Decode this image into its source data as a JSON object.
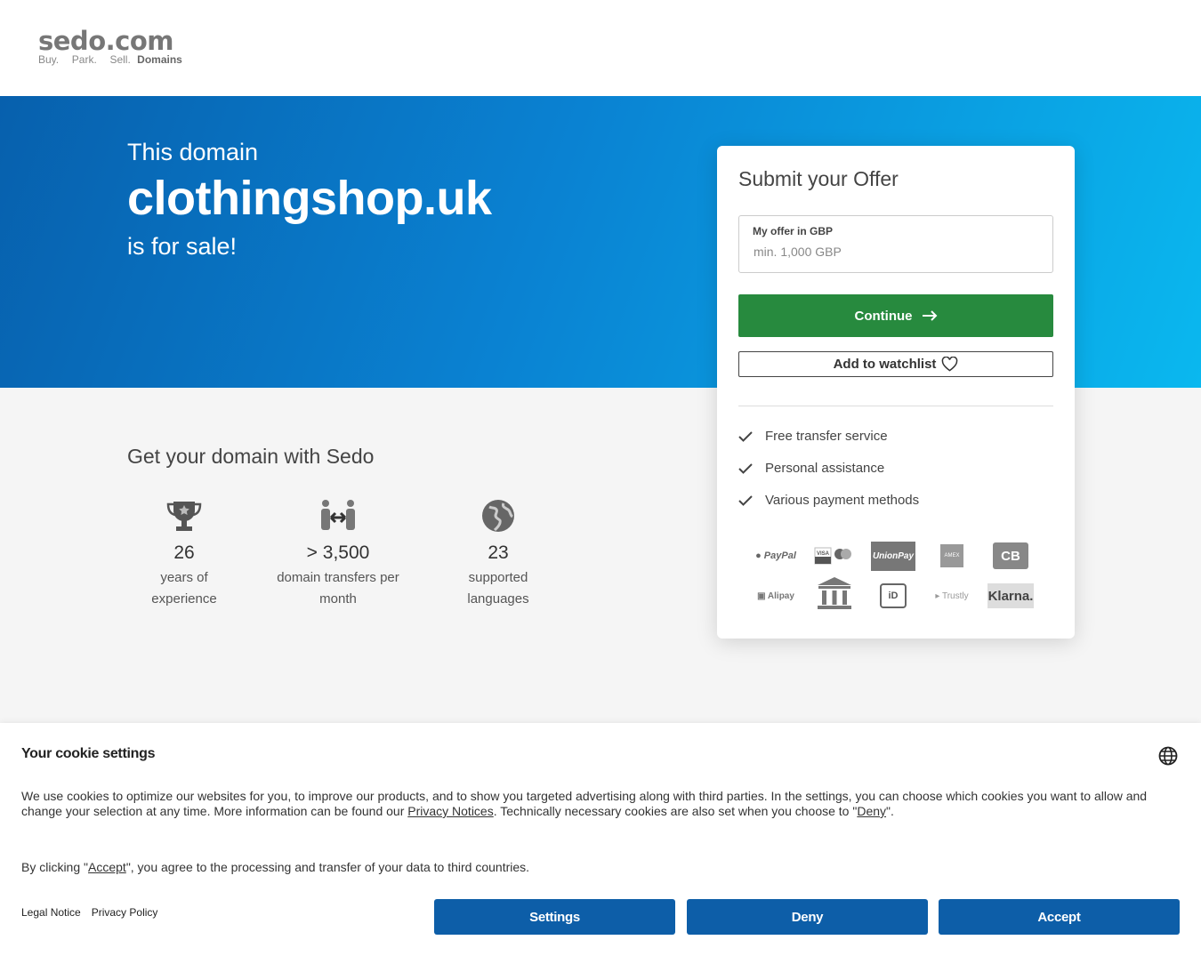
{
  "logo": {
    "name": "sedo.com",
    "tagline_plain": "Buy.  Park.  Sell.",
    "tagline_bold": "Domains"
  },
  "hero": {
    "pre": "This domain",
    "domain": "clothingshop.uk",
    "post": "is for sale!"
  },
  "features": {
    "title": "Get your domain with Sedo",
    "stats": [
      {
        "icon": "trophy-icon",
        "value": "26",
        "label": "years of experience"
      },
      {
        "icon": "transfer-icon",
        "value": "> 3,500",
        "label": "domain transfers per month"
      },
      {
        "icon": "globe-icon",
        "value": "23",
        "label": "supported languages"
      }
    ]
  },
  "offer": {
    "title": "Submit your Offer",
    "field_label": "My offer in GBP",
    "field_placeholder": "min. 1,000 GBP",
    "field_value": "",
    "continue_label": "Continue",
    "watchlist_label": "Add to watchlist",
    "benefits": [
      "Free transfer service",
      "Personal assistance",
      "Various payment methods"
    ],
    "payment_methods": [
      {
        "name": "PayPal",
        "text": "PayPal"
      },
      {
        "name": "Visa / Mastercard",
        "text": "VISA"
      },
      {
        "name": "UnionPay",
        "text": "UnionPay"
      },
      {
        "name": "American Express",
        "text": "AMEX"
      },
      {
        "name": "CB",
        "text": "CB"
      },
      {
        "name": "Alipay",
        "text": "Alipay"
      },
      {
        "name": "Bank transfer",
        "text": ""
      },
      {
        "name": "iDEAL",
        "text": "iD"
      },
      {
        "name": "Trustly",
        "text": "Trustly"
      },
      {
        "name": "Klarna",
        "text": "Klarna."
      }
    ]
  },
  "cookie": {
    "title": "Your cookie settings",
    "text_a": "We use cookies to optimize our websites for you, to improve our products, and to show you targeted advertising along with third parties. In the settings, you can choose which cookies you want to allow and change your selection at any time. More information can be found our ",
    "privacy_notices": "Privacy Notices",
    "text_b": ". Technically necessary cookies are also set when you choose to \"",
    "deny_link": "Deny",
    "text_c": "\".",
    "accept_pre": "By clicking \"",
    "accept_link": "Accept",
    "accept_post": "\", you agree to the processing and transfer of your data to third countries.",
    "legal_notice": "Legal Notice",
    "privacy_policy": "Privacy Policy",
    "settings_label": "Settings",
    "deny_label": "Deny",
    "accept_label": "Accept"
  },
  "colors": {
    "hero_start": "#0760ad",
    "hero_end": "#0ab8ef",
    "continue": "#278a3e",
    "cookie_button": "#0d5ea8"
  }
}
